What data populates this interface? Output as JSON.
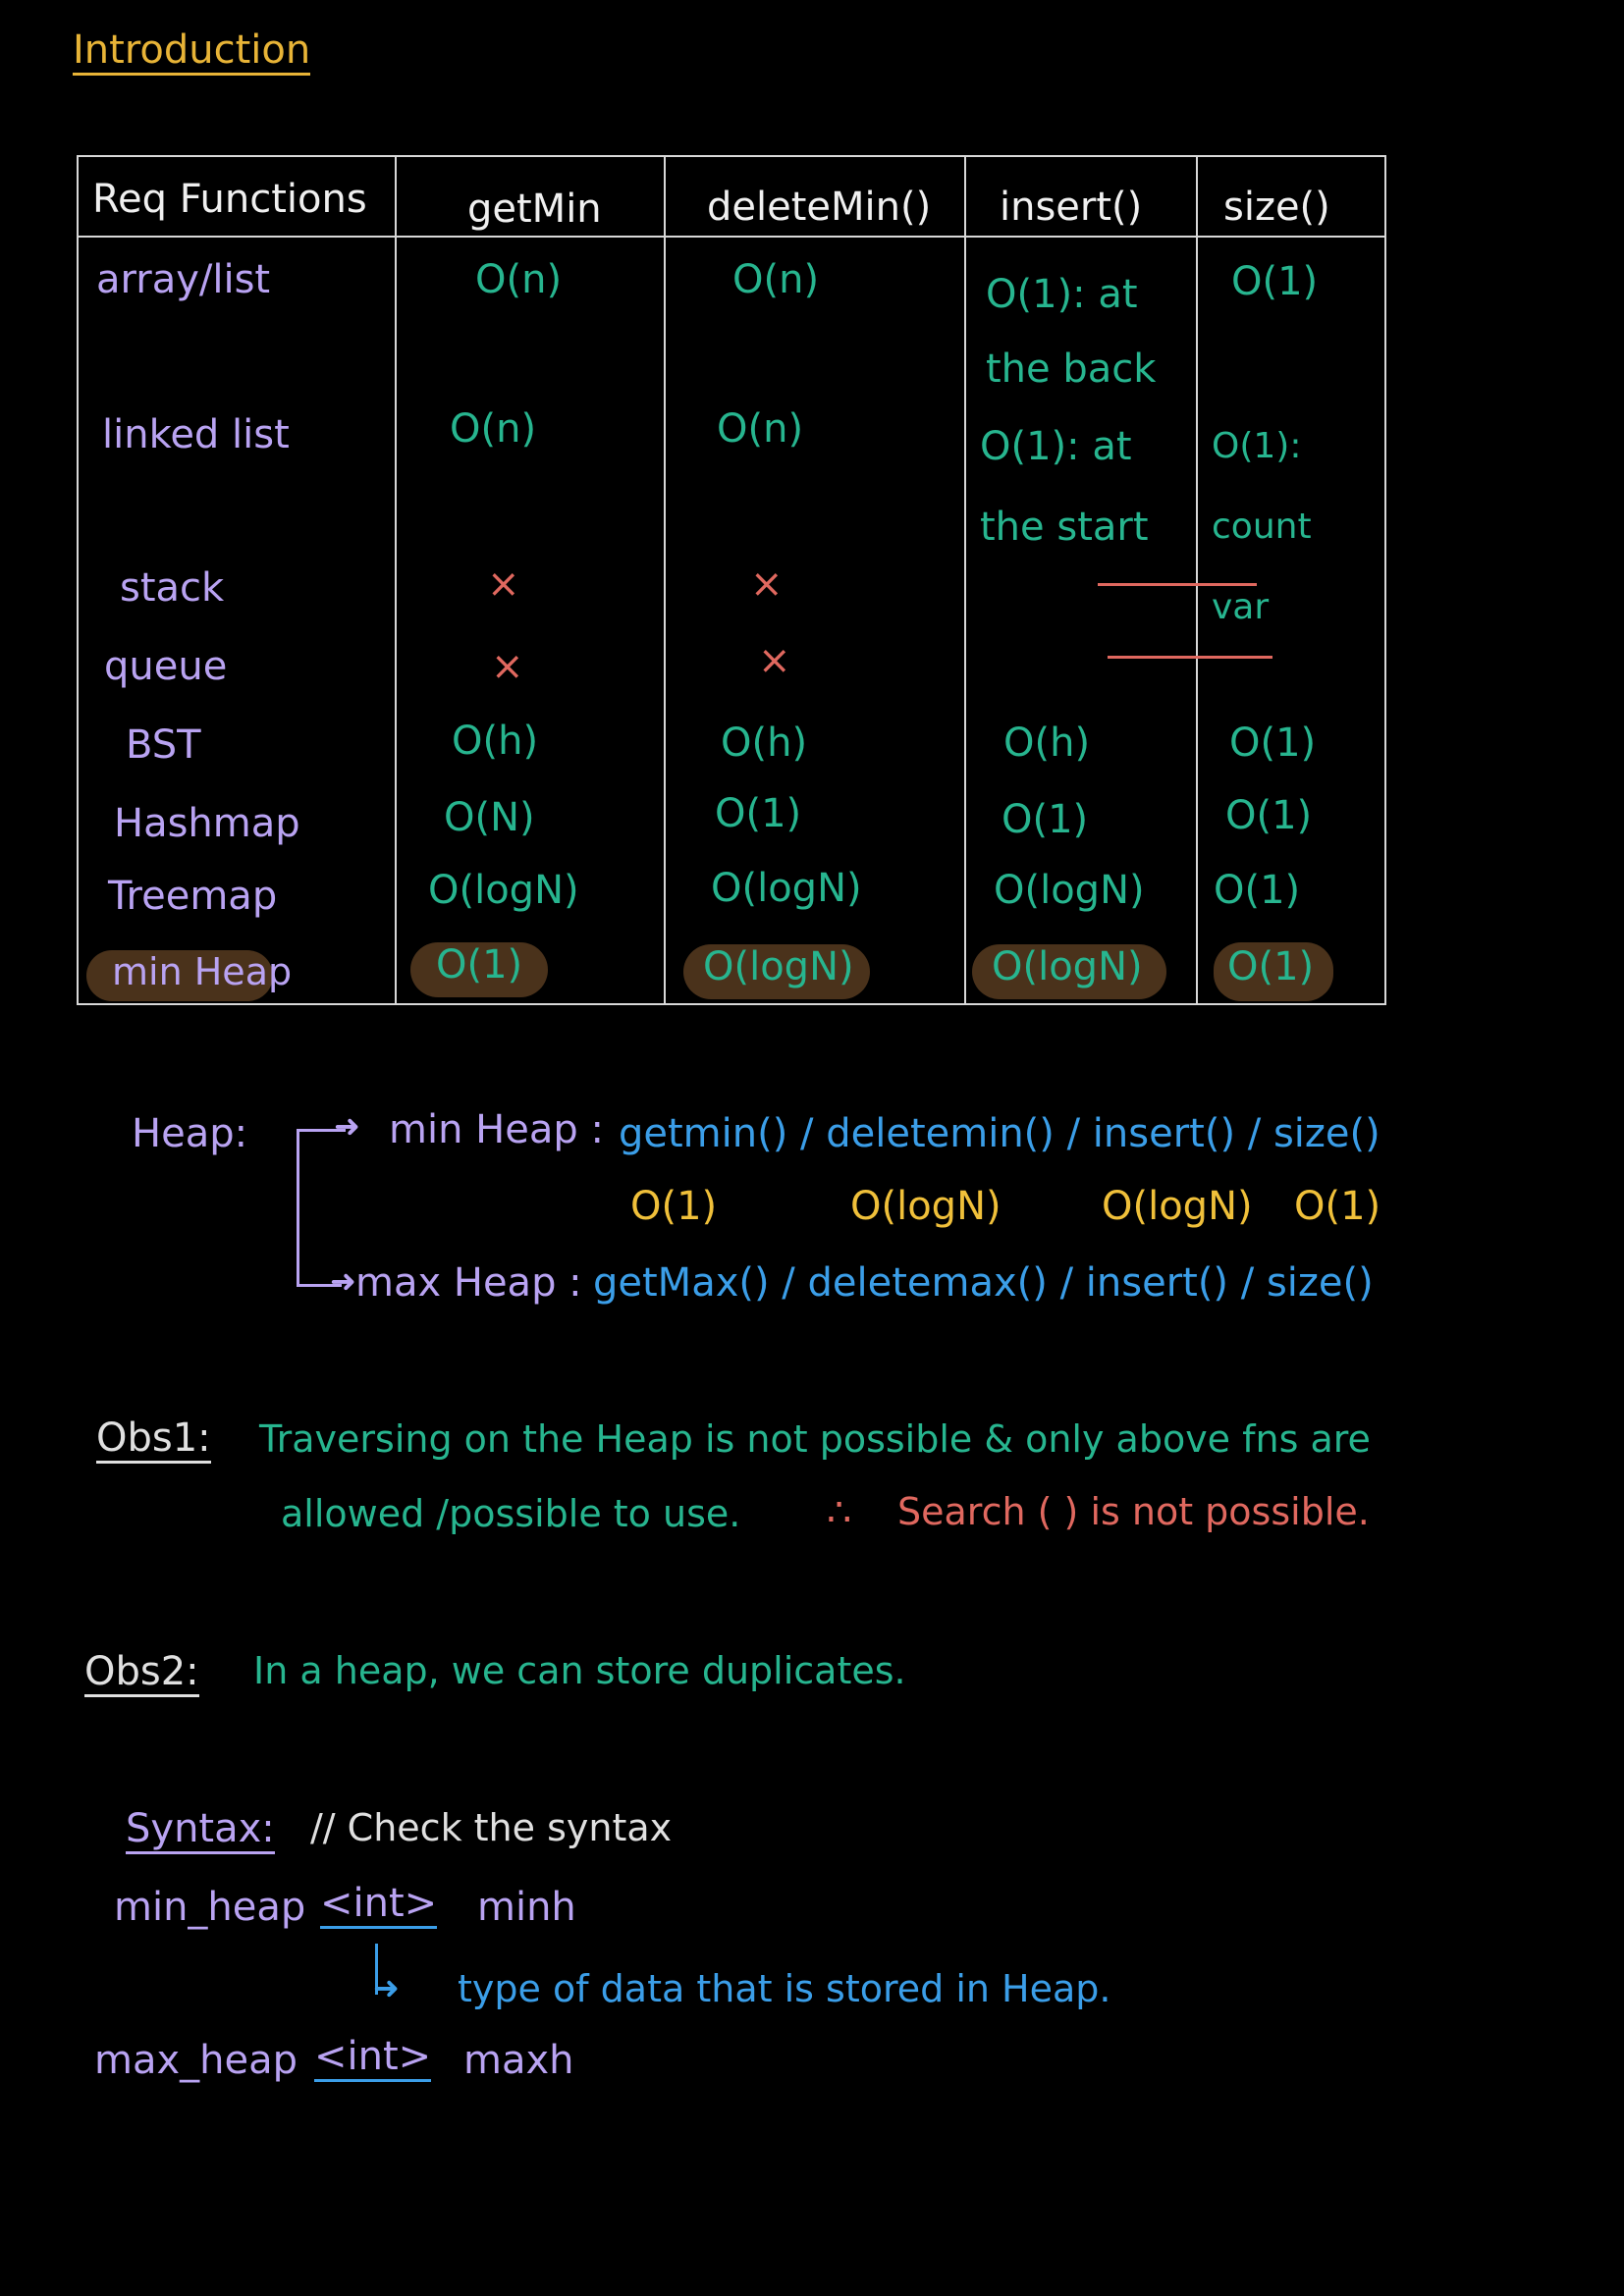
{
  "title": "Introduction",
  "table": {
    "headers": [
      "Req Functions",
      "getMin",
      "deleteMin()",
      "insert()",
      "size()"
    ],
    "rows": [
      {
        "name": "array/list",
        "getmin": "O(n)",
        "deletemin": "O(n)",
        "insert": "O(1): at the back",
        "size": "O(1)"
      },
      {
        "name": "linked list",
        "getmin": "O(n)",
        "deletemin": "O(n)",
        "insert": "O(1): at the start",
        "size": "O(1): count var"
      },
      {
        "name": "stack",
        "getmin": "×",
        "deletemin": "×"
      },
      {
        "name": "queue",
        "getmin": "×",
        "deletemin": "×"
      },
      {
        "name": "BST",
        "getmin": "O(h)",
        "deletemin": "O(h)",
        "insert": "O(h)",
        "size": "O(1)"
      },
      {
        "name": "Hashmap",
        "getmin": "O(N)",
        "deletemin": "O(1)",
        "insert": "O(1)",
        "size": "O(1)"
      },
      {
        "name": "Treemap",
        "getmin": "O(logN)",
        "deletemin": "O(logN)",
        "insert": "O(logN)",
        "size": "O(1)"
      },
      {
        "name": "min Heap",
        "getmin": "O(1)",
        "deletemin": "O(logN)",
        "insert": "O(logN)",
        "size": "O(1)"
      }
    ]
  },
  "heap": {
    "label": "Heap:",
    "min_label": "min Heap :",
    "min_fns": "getmin() / deletemin() / insert() / size()",
    "min_complexities": [
      "O(1)",
      "O(logN)",
      "O(logN)",
      "O(1)"
    ],
    "max_label": "max Heap :",
    "max_fns": "getMax() / deletemax() / insert() / size()"
  },
  "obs1": {
    "label": "Obs1:",
    "line1": "Traversing on the Heap is not possible & only above fns are",
    "line2": "allowed /possible to use.",
    "therefore": "∴",
    "conclusion": "Search ( ) is not possible."
  },
  "obs2": {
    "label": "Obs2:",
    "text": "In a heap, we can store duplicates."
  },
  "syntax": {
    "label": "Syntax:",
    "comment": "// Check the syntax",
    "min_prefix": "min_heap",
    "min_type": "<int>",
    "min_var": "minh",
    "type_note": "type of data that is stored in Heap.",
    "max_prefix": "max_heap",
    "max_type": "<int>",
    "max_var": "maxh"
  }
}
